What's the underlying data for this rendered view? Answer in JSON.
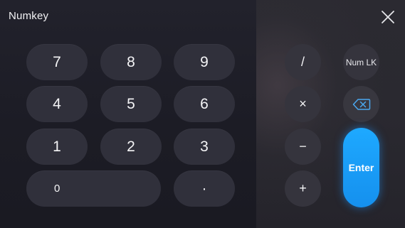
{
  "dialog": {
    "title": "Numkey"
  },
  "numpad": {
    "keys": {
      "k7": "7",
      "k8": "8",
      "k9": "9",
      "k4": "4",
      "k5": "5",
      "k6": "6",
      "k1": "1",
      "k2": "2",
      "k3": "3",
      "k0": "0",
      "decimal": "·"
    }
  },
  "operators": {
    "divide": "/",
    "multiply": "×",
    "subtract": "−",
    "add": "+",
    "numlock": "Num LK",
    "enter": "Enter"
  },
  "icons": {
    "close": "close-icon",
    "backspace": "backspace-icon"
  },
  "colors": {
    "background": "#1a1a22",
    "key": "#30303b",
    "operator": "#35343d",
    "enter": "#1ea9ff",
    "backspace_accent": "#4aa8f0"
  }
}
